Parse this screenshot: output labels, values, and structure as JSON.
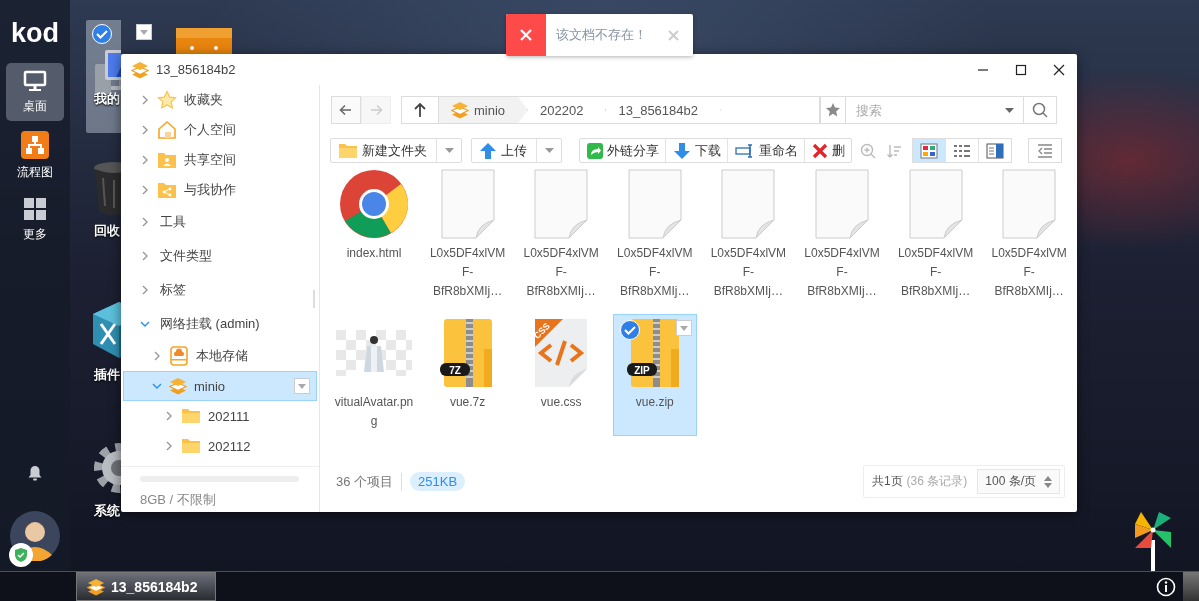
{
  "dock": {
    "logo": "kod",
    "items": [
      {
        "label": "桌面",
        "kind": "monitor",
        "selected": true
      },
      {
        "label": "流程图",
        "kind": "flow",
        "selected": false
      },
      {
        "label": "更多",
        "kind": "grid",
        "selected": false
      }
    ]
  },
  "desktop_icons": [
    {
      "label": "我的",
      "kind": "computer",
      "selected": true
    },
    {
      "kind": "bag",
      "selected": false
    },
    {
      "label": "回收",
      "kind": "trash",
      "selected": false
    },
    {
      "label": "插件",
      "kind": "cube",
      "selected": false
    },
    {
      "label": "系统",
      "kind": "gear",
      "selected": false
    }
  ],
  "toast": {
    "message": "该文档不存在！"
  },
  "window": {
    "title": "13_856184b2"
  },
  "sidebar": {
    "tree": [
      {
        "label": "收藏夹",
        "kind": "star",
        "expanded": false,
        "selected": false
      },
      {
        "label": "个人空间",
        "kind": "home",
        "expanded": false,
        "selected": false
      },
      {
        "label": "共享空间",
        "kind": "folder-user",
        "expanded": false,
        "selected": false
      },
      {
        "label": "与我协作",
        "kind": "folder-share",
        "expanded": false,
        "selected": false
      },
      {
        "label": "工具",
        "kind": "section",
        "expanded": false,
        "selected": false
      },
      {
        "label": "文件类型",
        "kind": "section",
        "expanded": false,
        "selected": false
      },
      {
        "label": "标签",
        "kind": "section",
        "expanded": false,
        "selected": false
      },
      {
        "label": "网络挂载 (admin)",
        "kind": "section",
        "expanded": true,
        "selected": false,
        "children": [
          {
            "label": "本地存储",
            "kind": "disk",
            "expanded": false,
            "selected": false
          },
          {
            "label": "minio",
            "kind": "layers",
            "expanded": true,
            "selected": true,
            "children": [
              {
                "label": "202111",
                "kind": "folder",
                "expanded": false,
                "selected": false
              },
              {
                "label": "202112",
                "kind": "folder",
                "expanded": false,
                "selected": false
              }
            ]
          }
        ]
      }
    ],
    "storage": {
      "level": 0,
      "text": "8GB / 不限制"
    }
  },
  "address_bar": {
    "back": {
      "disabled": false
    },
    "forward": {
      "disabled": true
    },
    "breadcrumbs": [
      "minio",
      "202202",
      "13_856184b2"
    ],
    "search": {
      "placeholder": "搜索"
    }
  },
  "toolbar": {
    "buttons": [
      {
        "label": "新建文件夹",
        "kind": "folder",
        "dropdown": true
      },
      {
        "label": "上传",
        "kind": "up",
        "dropdown": true
      },
      {
        "label": "外链分享",
        "kind": "share",
        "dropdown": false
      },
      {
        "label": "下载",
        "kind": "down",
        "dropdown": false
      },
      {
        "label": "重命名",
        "kind": "rename",
        "dropdown": false
      },
      {
        "label": "删",
        "kind": "delete",
        "dropdown": false
      }
    ],
    "views": [
      {
        "kind": "icons",
        "selected": true
      },
      {
        "kind": "list",
        "selected": false
      },
      {
        "kind": "split",
        "selected": false
      }
    ]
  },
  "files": [
    {
      "name": "index.html",
      "kind": "browser",
      "selected": false
    },
    {
      "name": "L0x5DF4xlVMF-BfR8bXMIj…",
      "kind": "doc",
      "selected": false
    },
    {
      "name": "L0x5DF4xlVMF-BfR8bXMIj…",
      "kind": "doc",
      "selected": false
    },
    {
      "name": "L0x5DF4xlVMF-BfR8bXMIj…",
      "kind": "doc",
      "selected": false
    },
    {
      "name": "L0x5DF4xlVMF-BfR8bXMIj…",
      "kind": "doc",
      "selected": false
    },
    {
      "name": "L0x5DF4xlVMF-BfR8bXMIj…",
      "kind": "doc",
      "selected": false
    },
    {
      "name": "L0x5DF4xlVMF-BfR8bXMIj…",
      "kind": "doc",
      "selected": false
    },
    {
      "name": "L0x5DF4xlVMF-BfR8bXMIj…",
      "kind": "doc",
      "selected": false
    },
    {
      "name": "vitualAvatar.png",
      "kind": "picture",
      "selected": false
    },
    {
      "name": "vue.7z",
      "kind": "archive",
      "badge": "7Z",
      "selected": false
    },
    {
      "name": "vue.css",
      "kind": "code",
      "badge": "CSS",
      "selected": false
    },
    {
      "name": "vue.zip",
      "kind": "archive",
      "badge": "ZIP",
      "selected": true
    }
  ],
  "footer": {
    "count": "36 个项目",
    "size": "251KB",
    "pages": "共1页",
    "records": "(36 条记录)",
    "page_size": "100 条/页"
  },
  "taskbar": {
    "tasks": [
      {
        "label": "13_856184b2",
        "selected": true
      }
    ]
  }
}
